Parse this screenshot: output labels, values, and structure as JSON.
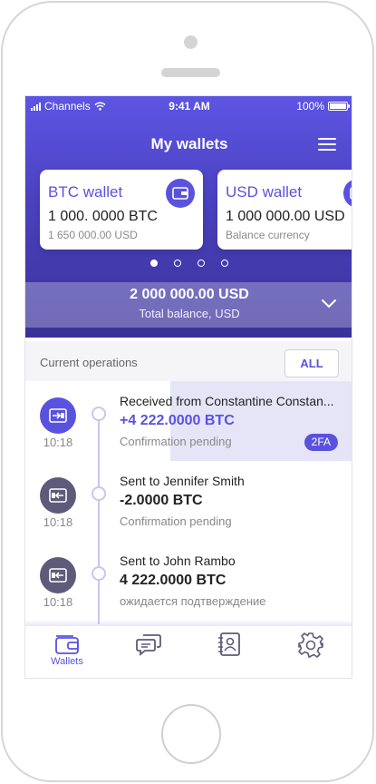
{
  "status_bar": {
    "carrier": "Channels",
    "time": "9:41 AM",
    "battery": "100%"
  },
  "header": {
    "title": "My wallets"
  },
  "wallets": [
    {
      "name": "BTC wallet",
      "amount": "1 000. 0000 BTC",
      "sub": "1 650 000.00 USD"
    },
    {
      "name": "USD wallet",
      "amount": "1 000 000.00 USD",
      "sub": "Balance currency"
    }
  ],
  "pager": {
    "count": 4,
    "active": 0
  },
  "total": {
    "value": "2 000 000.00 USD",
    "label": "Total balance, USD"
  },
  "operations": {
    "title": "Current operations",
    "all_label": "ALL",
    "items": [
      {
        "title": "Received from Constantine Constan...",
        "amount": "+4 222.0000 BTC",
        "status": "Confirmation pending",
        "time": "10:18",
        "badge": "2FA"
      },
      {
        "title": "Sent to Jennifer Smith",
        "amount": "-2.0000 BTC",
        "status": "Confirmation pending",
        "time": "10:18"
      },
      {
        "title": "Sent to John Rambo",
        "amount": "4 222.0000 BTC",
        "status": "ожидается подтверждение",
        "time": "10:18"
      }
    ]
  },
  "tabbar": {
    "wallets_label": "Wallets",
    "icons": [
      "wallet-icon",
      "chat-icon",
      "contacts-icon",
      "gear-icon"
    ]
  },
  "colors": {
    "accent": "#5a52df",
    "dark_icon": "#5e5a7a",
    "highlight": "#e6e5f7"
  }
}
